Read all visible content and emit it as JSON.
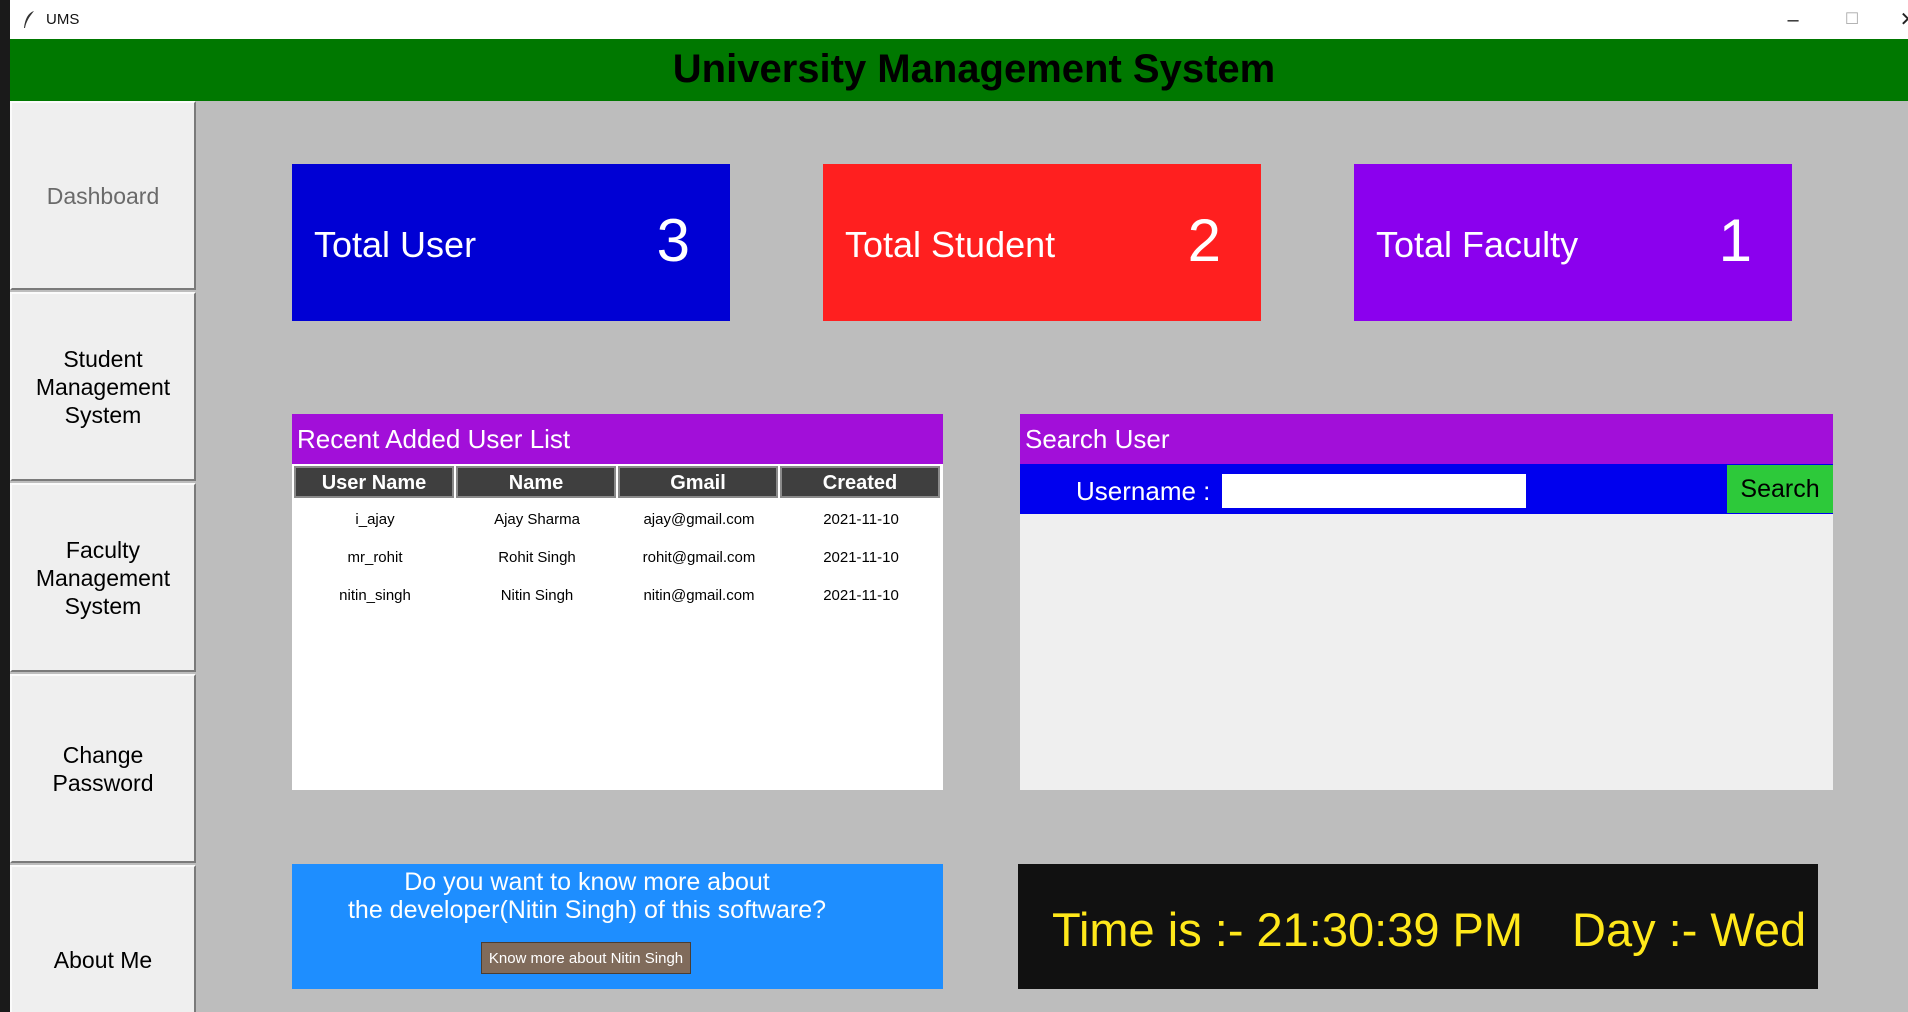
{
  "window": {
    "title": "UMS"
  },
  "header": {
    "title": "University Management System"
  },
  "sidebar": {
    "items": [
      {
        "label": "Dashboard"
      },
      {
        "label": "Student\nManagement\nSystem"
      },
      {
        "label": "Faculty\nManagement\nSystem"
      },
      {
        "label": "Change\nPassword"
      },
      {
        "label": "About Me"
      }
    ]
  },
  "stats": [
    {
      "label": "Total User",
      "value": "3",
      "color": "#0000d4"
    },
    {
      "label": "Total Student",
      "value": "2",
      "color": "#ff1f1f"
    },
    {
      "label": "Total Faculty",
      "value": "1",
      "color": "#8b00ee"
    }
  ],
  "recent_users": {
    "title": "Recent Added User List",
    "columns": [
      "User Name",
      "Name",
      "Gmail",
      "Created"
    ],
    "rows": [
      [
        "i_ajay",
        "Ajay Sharma",
        "ajay@gmail.com",
        "2021-11-10"
      ],
      [
        "mr_rohit",
        "Rohit Singh",
        "rohit@gmail.com",
        "2021-11-10"
      ],
      [
        "nitin_singh",
        "Nitin Singh",
        "nitin@gmail.com",
        "2021-11-10"
      ]
    ]
  },
  "search": {
    "title": "Search User",
    "username_label": "Username :",
    "username_value": "",
    "button_label": "Search"
  },
  "developer": {
    "line1": "Do you want to know more about",
    "line2": "the developer(Nitin Singh) of this software?",
    "button_label": "Know more about Nitin Singh"
  },
  "clock": {
    "time": "Time is :- 21:30:39 PM",
    "day": "Day :- Wed"
  },
  "colors": {
    "header": "#007800",
    "panel_header": "#a20fd9",
    "search_bar": "#0000ee",
    "search_button": "#2dc93a",
    "promo": "#1e8eff",
    "clock_text": "#ffe81a"
  }
}
